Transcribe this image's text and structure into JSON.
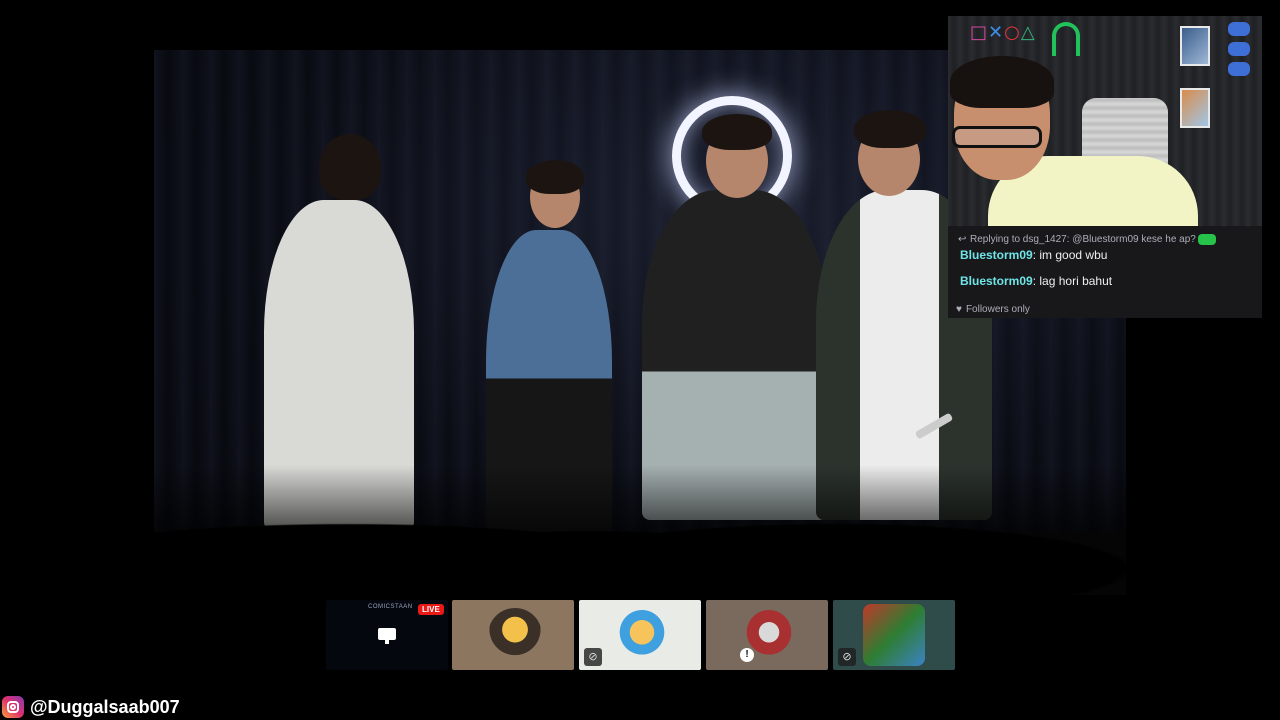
{
  "webcam": {
    "ps_symbols": [
      "□",
      "✕",
      "○",
      "△"
    ],
    "chat": {
      "reply_to": "Replying to dsg_1427: @Bluestorm09 kese he ap?",
      "messages": [
        {
          "user": "Bluestorm09",
          "text": ": im good wbu"
        },
        {
          "user": "Bluestorm09",
          "text": ": lag hori bahut"
        }
      ],
      "mode": "Followers only",
      "username_color": "#6ee4e7"
    }
  },
  "thumbnails": {
    "first": {
      "channel": "COMICSTAAN",
      "live_label": "LIVE"
    },
    "muted_icon": "mic-off-icon"
  },
  "footer": {
    "handle": "@Duggalsaab007",
    "icon": "instagram-icon"
  }
}
